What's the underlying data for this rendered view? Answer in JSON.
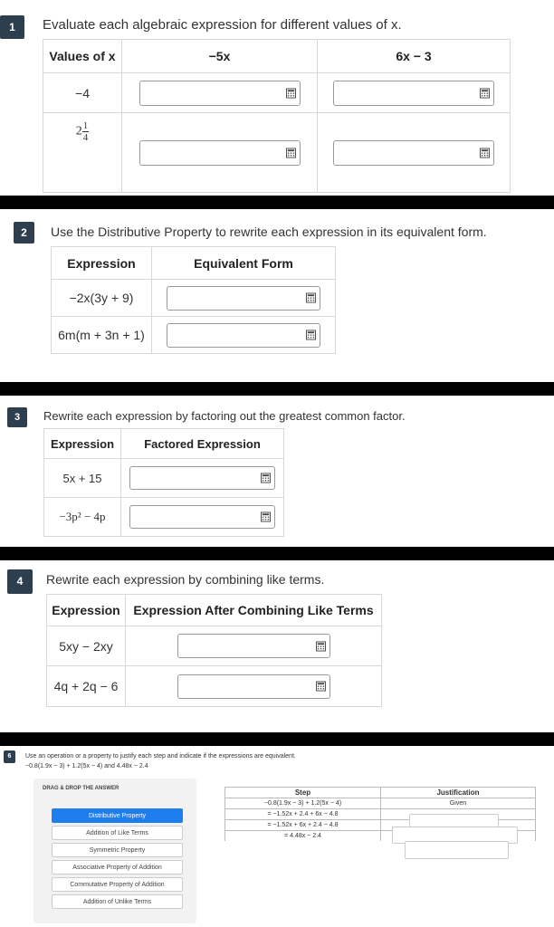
{
  "q1": {
    "number": "1",
    "prompt": "Evaluate each algebraic expression for different values of x.",
    "headers": [
      "Values of x",
      "−5x",
      "6x − 3"
    ],
    "row1_value": "−4",
    "row2_whole": "2",
    "row2_num": "1",
    "row2_den": "4"
  },
  "q2": {
    "number": "2",
    "prompt": "Use the Distributive Property to rewrite each expression in its equivalent form.",
    "headers": [
      "Expression",
      "Equivalent Form"
    ],
    "rows": [
      "−2x(3y + 9)",
      "6m(m + 3n + 1)"
    ]
  },
  "q3": {
    "number": "3",
    "prompt": "Rewrite each expression by factoring out the greatest common factor.",
    "headers": [
      "Expression",
      "Factored Expression"
    ],
    "rows": [
      "5x + 15",
      "−3p² − 4p"
    ]
  },
  "q4": {
    "number": "4",
    "prompt": "Rewrite each expression by combining like terms.",
    "headers": [
      "Expression",
      "Expression After Combining Like Terms"
    ],
    "rows": [
      "5xy − 2xy",
      "4q + 2q − 6"
    ]
  },
  "q6": {
    "number": "6",
    "prompt": "Use an operation or a property to justify each step and indicate if the expressions are equivalent.",
    "expression_line": "−0.8(1.9x − 3) + 1.2(5x − 4) and 4.48x − 2.4",
    "drag_title": "DRAG & DROP THE ANSWER",
    "chips": [
      "Distributive Property",
      "Addition of Like Terms",
      "Symmetric Property",
      "Associative Property of Addition",
      "Commutative Property of Addition",
      "Addition of Unlike Terms"
    ],
    "step_header": "Step",
    "justification_header": "Justification",
    "steps": [
      "−0.8(1.9x − 3) + 1.2(5x − 4)",
      "= −1.52x + 2.4 + 6x − 4.8",
      "= −1.52x + 6x + 2.4 − 4.8",
      "= 4.48x − 2.4"
    ],
    "justification_given": "Given"
  },
  "colors": {
    "badge": "#2d3e4e",
    "selected_chip": "#1e7ef0",
    "divider": "#000000"
  },
  "icons": {
    "calculator": "calculator-icon"
  }
}
